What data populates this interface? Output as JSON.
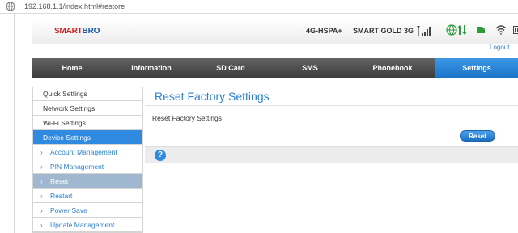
{
  "browser": {
    "url": "192.168.1.1/index.html#restore"
  },
  "brand": {
    "part1": "SMART",
    "part2": "BRO"
  },
  "status": {
    "network_type": "4G-HSPA+",
    "operator": "SMART GOLD 3G"
  },
  "header": {
    "logout_label": "Logout"
  },
  "nav": {
    "tabs": [
      {
        "label": "Home"
      },
      {
        "label": "Information"
      },
      {
        "label": "SD Card"
      },
      {
        "label": "SMS"
      },
      {
        "label": "Phonebook"
      },
      {
        "label": "Settings"
      }
    ],
    "active_index": 5
  },
  "sidebar": {
    "items": [
      {
        "label": "Quick Settings"
      },
      {
        "label": "Network Settings"
      },
      {
        "label": "Wi-Fi Settings"
      },
      {
        "label": "Device Settings"
      }
    ],
    "sub_items": [
      {
        "label": "Account Management"
      },
      {
        "label": "PIN Management"
      },
      {
        "label": "Reset"
      },
      {
        "label": "Restart"
      },
      {
        "label": "Power Save"
      },
      {
        "label": "Update Management"
      }
    ]
  },
  "main": {
    "title": "Reset Factory Settings",
    "section_label": "Reset Factory Settings",
    "reset_button_label": "Reset"
  },
  "colors": {
    "accent": "#2f8ae0",
    "nav_bg": "#4a4a4a",
    "brand_red": "#d21c1c",
    "brand_blue": "#1a5aa8"
  },
  "icons": [
    "globe-icon",
    "signal-icon",
    "internet-globe-icon",
    "updown-arrows-icon",
    "sim-icon",
    "wifi-icon",
    "battery-icon",
    "chevron-right-icon",
    "help-icon"
  ]
}
